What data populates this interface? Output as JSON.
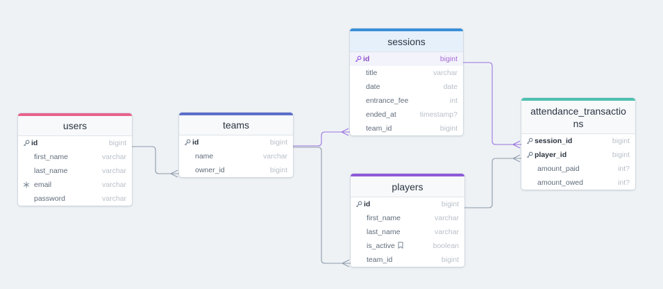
{
  "colors": {
    "users": "#e8628b",
    "teams": "#5b6ec9",
    "sessions": "#3a8fd8",
    "players": "#8d5ad8",
    "attendance_transactions": "#4dc0b0",
    "connector": "#8e9bab",
    "connector_active": "#9a73e0"
  },
  "tables": {
    "users": {
      "name": "users",
      "fields": [
        {
          "name": "id",
          "type": "bigint",
          "icon": "key-icon",
          "bold": true
        },
        {
          "name": "first_name",
          "type": "varchar"
        },
        {
          "name": "last_name",
          "type": "varchar"
        },
        {
          "name": "email",
          "type": "varchar",
          "icon": "snowflake-icon"
        },
        {
          "name": "password",
          "type": "varchar"
        }
      ]
    },
    "teams": {
      "name": "teams",
      "fields": [
        {
          "name": "id",
          "type": "bigint",
          "icon": "key-icon",
          "bold": true
        },
        {
          "name": "name",
          "type": "varchar"
        },
        {
          "name": "owner_id",
          "type": "bigint"
        }
      ]
    },
    "sessions": {
      "name": "sessions",
      "fields": [
        {
          "name": "id",
          "type": "bigint",
          "icon": "key-icon",
          "bold": true,
          "highlight": true
        },
        {
          "name": "title",
          "type": "varchar"
        },
        {
          "name": "date",
          "type": "date"
        },
        {
          "name": "entrance_fee",
          "type": "int"
        },
        {
          "name": "ended_at",
          "type": "timestamp?"
        },
        {
          "name": "team_id",
          "type": "bigint"
        }
      ]
    },
    "players": {
      "name": "players",
      "fields": [
        {
          "name": "id",
          "type": "bigint",
          "icon": "key-icon",
          "bold": true
        },
        {
          "name": "first_name",
          "type": "varchar"
        },
        {
          "name": "last_name",
          "type": "varchar"
        },
        {
          "name": "is_active",
          "type": "boolean",
          "note": "bookmark-icon"
        },
        {
          "name": "team_id",
          "type": "bigint"
        }
      ]
    },
    "attendance_transactions": {
      "name": "attendance_transactions",
      "fields": [
        {
          "name": "session_id",
          "type": "bigint",
          "icon": "key-icon",
          "bold": true
        },
        {
          "name": "player_id",
          "type": "bigint",
          "icon": "key-icon",
          "bold": true
        },
        {
          "name": "amount_paid",
          "type": "int?"
        },
        {
          "name": "amount_owed",
          "type": "int?"
        }
      ]
    }
  }
}
